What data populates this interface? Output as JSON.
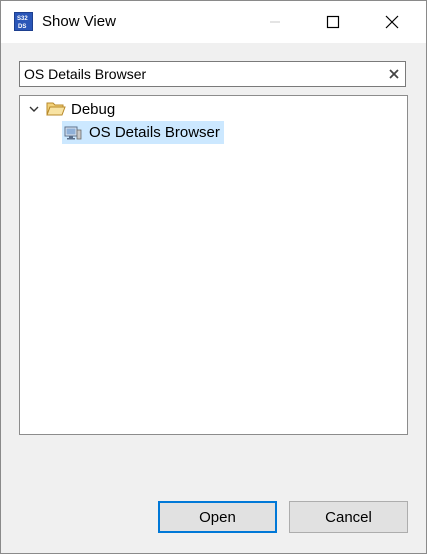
{
  "window": {
    "title": "Show View",
    "app_icon": "s32ds-logo-icon"
  },
  "search": {
    "value": "OS Details Browser",
    "clear_icon": "clear-icon"
  },
  "tree": {
    "nodes": [
      {
        "label": "Debug",
        "icon": "folder-open-icon",
        "expanded": true
      },
      {
        "label": "OS Details Browser",
        "icon": "view-icon",
        "selected": true
      }
    ]
  },
  "buttons": {
    "open_label": "Open",
    "cancel_label": "Cancel"
  },
  "colors": {
    "accent": "#0078d7",
    "selection": "#cce8ff"
  }
}
